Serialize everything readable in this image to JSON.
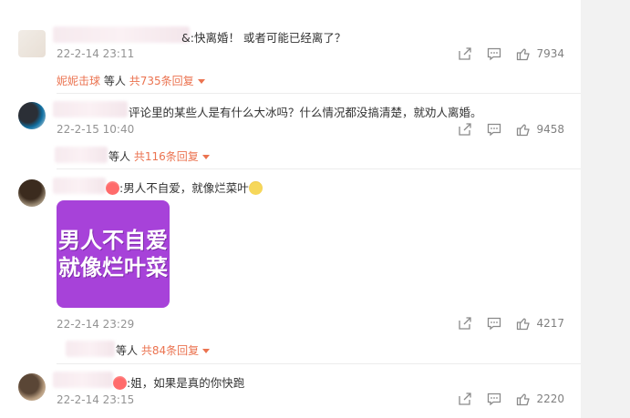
{
  "comments": [
    {
      "text_tail": "&:快离婚！ 或者可能已经离了？",
      "date": "22-2-14 23:11",
      "likes": "7934",
      "reply_user": "妮妮击球",
      "reply_suffix": "等人",
      "reply_count": "共735条回复"
    },
    {
      "text_tail": "评论里的某些人是有什么大冰吗？什么情况都没搞清楚，就劝人离婚。",
      "date": "22-2-15 10:40",
      "likes": "9458",
      "reply_suffix": "等人",
      "reply_count": "共116条回复"
    },
    {
      "text_tail": ":男人不自爱，就像烂菜叶",
      "sticker_line1": "男人不自爱",
      "sticker_line2": "就像烂叶菜",
      "date": "22-2-14 23:29",
      "likes": "4217",
      "reply_suffix": "等人",
      "reply_count": "共84条回复"
    },
    {
      "text_tail": ":姐，如果是真的你快跑",
      "date": "22-2-14 23:15",
      "likes": "2220"
    }
  ],
  "icons": {
    "share": "share-icon",
    "comment": "comment-icon",
    "like": "thumbs-up-icon"
  },
  "colors": {
    "accent": "#eb7350",
    "sticker": "#a742d9",
    "gutter": "#f2f2f2"
  }
}
